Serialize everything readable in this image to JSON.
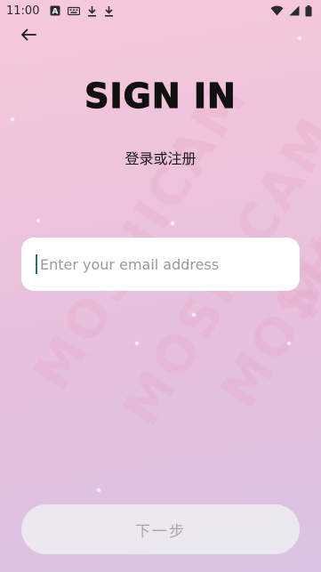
{
  "status_bar": {
    "time": "11:00"
  },
  "header": {
    "title": "SIGN IN",
    "subtitle": "登录或注册"
  },
  "form": {
    "email_placeholder": "Enter your email address",
    "email_value": ""
  },
  "actions": {
    "next_label": "下一步"
  },
  "watermark": {
    "text": "MOSHICAM"
  },
  "colors": {
    "accent_caret": "#1e7a5b",
    "title": "#111111",
    "button_text_disabled": "#a7a7a7"
  },
  "icons": [
    "back-arrow-icon",
    "a-notification-icon",
    "keyboard-icon",
    "download-icon",
    "wifi-icon",
    "signal-icon",
    "battery-icon"
  ]
}
